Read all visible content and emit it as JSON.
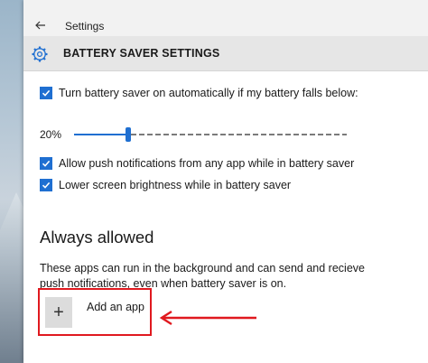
{
  "window": {
    "title": "Settings",
    "back_icon": "arrow-left-icon"
  },
  "header": {
    "icon": "gear-icon",
    "title": "BATTERY SAVER SETTINGS"
  },
  "settings": {
    "auto_on_label": "Turn battery saver on automatically if my battery falls below:",
    "auto_on_checked": true,
    "threshold_value": "20%",
    "threshold_percent": 20,
    "push_notifications_label": "Allow push notifications from any app while in battery saver",
    "push_notifications_checked": true,
    "lower_brightness_label": "Lower screen brightness while in battery saver",
    "lower_brightness_checked": true
  },
  "always_allowed": {
    "heading": "Always allowed",
    "description": "These apps can run in the background and can send and recieve push notifications, even when battery saver is on.",
    "add_button_symbol": "+",
    "add_button_label": "Add an app"
  },
  "colors": {
    "accent": "#1f6fd1",
    "annotation": "#e0191f"
  }
}
